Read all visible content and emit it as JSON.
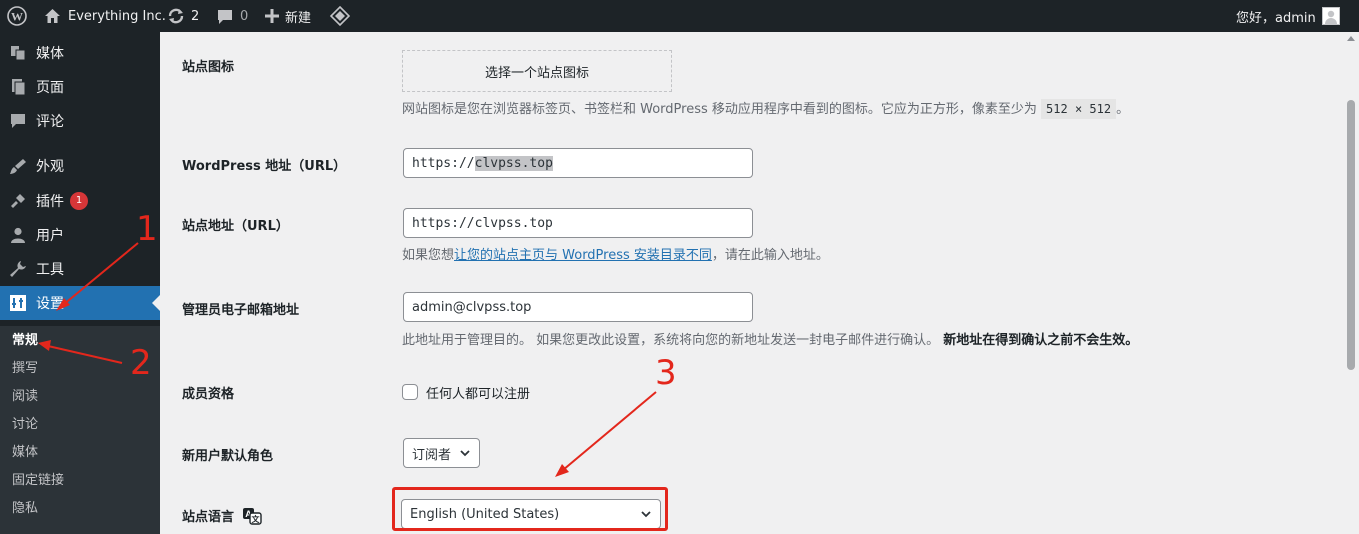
{
  "adminbar": {
    "site_name": "Everything Inc.",
    "updates_count": "2",
    "comments_count": "0",
    "new_label": "新建",
    "greeting": "您好，admin"
  },
  "sidebar": {
    "items": [
      {
        "label": "媒体",
        "icon": "media-icon"
      },
      {
        "label": "页面",
        "icon": "page-icon"
      },
      {
        "label": "评论",
        "icon": "comment-icon"
      },
      {
        "label": "外观",
        "icon": "appearance-icon"
      },
      {
        "label": "插件",
        "icon": "plugin-icon",
        "badge": "1"
      },
      {
        "label": "用户",
        "icon": "user-icon"
      },
      {
        "label": "工具",
        "icon": "tools-icon"
      },
      {
        "label": "设置",
        "icon": "settings-icon",
        "current": true
      }
    ],
    "submenu": [
      "常规",
      "撰写",
      "阅读",
      "讨论",
      "媒体",
      "固定链接",
      "隐私"
    ]
  },
  "settings": {
    "site_icon": {
      "label": "站点图标",
      "button": "选择一个站点图标",
      "desc_before": "网站图标是您在浏览器标签页、书签栏和 WordPress 移动应用程序中看到的图标。它应为正方形，像素至少为",
      "size_code": "512 × 512",
      "desc_after": "。"
    },
    "wp_url": {
      "label": "WordPress 地址（URL）",
      "value_prefix": "https://",
      "value_selected": "clvpss.top"
    },
    "site_url": {
      "label": "站点地址（URL）",
      "value": "https://clvpss.top",
      "desc_before": "如果您想",
      "desc_link": "让您的站点主页与 WordPress 安装目录不同",
      "desc_after": "，请在此输入地址。"
    },
    "admin_email": {
      "label": "管理员电子邮箱地址",
      "value": "admin@clvpss.top",
      "desc": "此地址用于管理目的。 如果您更改此设置，系统将向您的新地址发送一封电子邮件进行确认。",
      "desc_bold": "新地址在得到确认之前不会生效。"
    },
    "membership": {
      "label": "成员资格",
      "checkbox_label": "任何人都可以注册",
      "checked": false
    },
    "default_role": {
      "label": "新用户默认角色",
      "value": "订阅者"
    },
    "site_language": {
      "label": "站点语言",
      "value": "English (United States)"
    }
  },
  "annotations": {
    "color": "#e3271c",
    "numbers": [
      "1",
      "2",
      "3"
    ]
  },
  "colors": {
    "adminbar_bg": "#1d2327",
    "current_menu": "#2271b1",
    "link": "#2271b1",
    "badge": "#d63638"
  }
}
